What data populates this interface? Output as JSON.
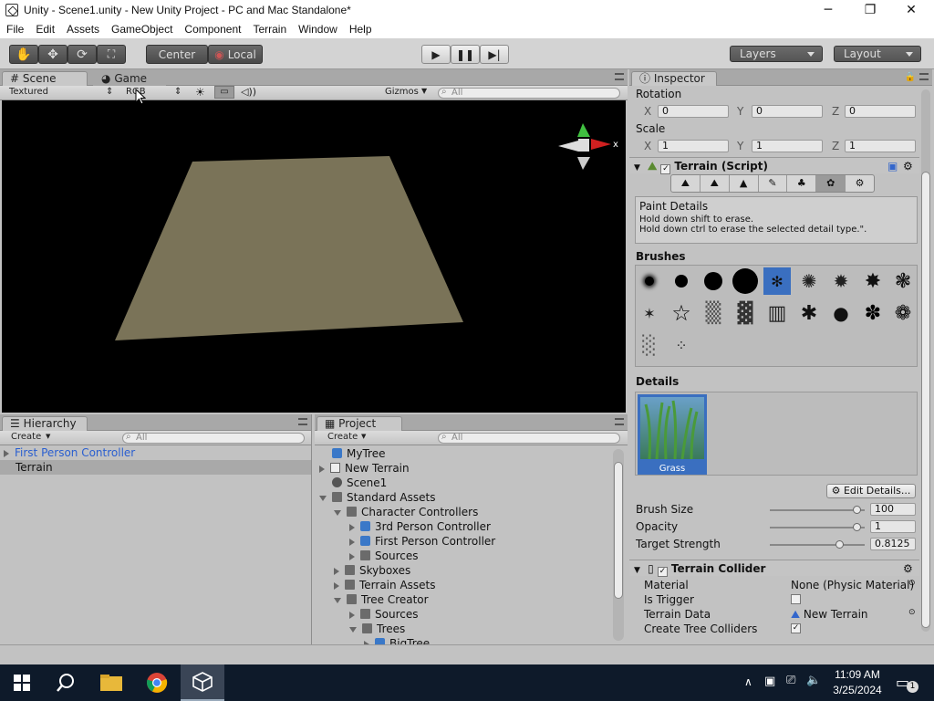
{
  "window": {
    "title": "Unity - Scene1.unity - New Unity Project - PC and Mac Standalone*",
    "minimize": "─",
    "maximize": "❐",
    "close": "✕"
  },
  "menu": [
    "File",
    "Edit",
    "Assets",
    "GameObject",
    "Component",
    "Terrain",
    "Window",
    "Help"
  ],
  "toolbar": {
    "center_label": "Center",
    "local_label": "Local",
    "layers_label": "Layers",
    "layout_label": "Layout"
  },
  "scene_panel": {
    "tabs": [
      "Scene",
      "Game"
    ],
    "render_mode": "Textured",
    "color_mode": "RGB",
    "gizmos_label": "Gizmos",
    "search_placeholder": "All",
    "gizmo_axis_label": "x",
    "terrain_color": "#7a7358"
  },
  "hierarchy": {
    "tab": "Hierarchy",
    "create_label": "Create",
    "search_placeholder": "All",
    "items": [
      {
        "label": "First Person Controller",
        "prefab": true
      },
      {
        "label": "Terrain",
        "prefab": false
      }
    ]
  },
  "project": {
    "tab": "Project",
    "create_label": "Create",
    "search_placeholder": "All",
    "items": [
      {
        "label": "MyTree"
      },
      {
        "label": "New Terrain"
      },
      {
        "label": "Scene1"
      },
      {
        "label": "Standard Assets"
      },
      {
        "label": "Character Controllers"
      },
      {
        "label": "3rd Person Controller"
      },
      {
        "label": "First Person Controller"
      },
      {
        "label": "Sources"
      },
      {
        "label": "Skyboxes"
      },
      {
        "label": "Terrain Assets"
      },
      {
        "label": "Tree Creator"
      },
      {
        "label": "Sources"
      },
      {
        "label": "Trees"
      },
      {
        "label": "BigTree"
      }
    ]
  },
  "inspector": {
    "tab": "Inspector",
    "rotation_label": "Rotation",
    "scale_label": "Scale",
    "rotation": {
      "x": "0",
      "y": "0",
      "z": "0"
    },
    "scale": {
      "x": "1",
      "y": "1",
      "z": "1"
    },
    "axis": {
      "x": "X",
      "y": "Y",
      "z": "Z"
    },
    "terrain_script": {
      "title": "Terrain (Script)",
      "help_title": "Paint Details",
      "help_line1": "Hold down shift to erase.",
      "help_line2": "Hold down ctrl to erase the selected detail type.\".",
      "brushes_label": "Brushes",
      "details_label": "Details",
      "detail_name": "Grass",
      "edit_details_label": "Edit Details...",
      "brush_size_label": "Brush Size",
      "brush_size": "100",
      "brush_size_fraction": 1.0,
      "opacity_label": "Opacity",
      "opacity": "1",
      "opacity_fraction": 1.0,
      "target_strength_label": "Target Strength",
      "target_strength": "0.8125",
      "target_strength_fraction": 0.8125
    },
    "collider": {
      "title": "Terrain Collider",
      "material_label": "Material",
      "material_value": "None (Physic Material)",
      "is_trigger_label": "Is Trigger",
      "terrain_data_label": "Terrain Data",
      "terrain_data_value": "New Terrain",
      "create_tree_colliders_label": "Create Tree Colliders"
    }
  },
  "taskbar": {
    "time": "11:09 AM",
    "date": "3/25/2024",
    "notification_count": "1"
  }
}
